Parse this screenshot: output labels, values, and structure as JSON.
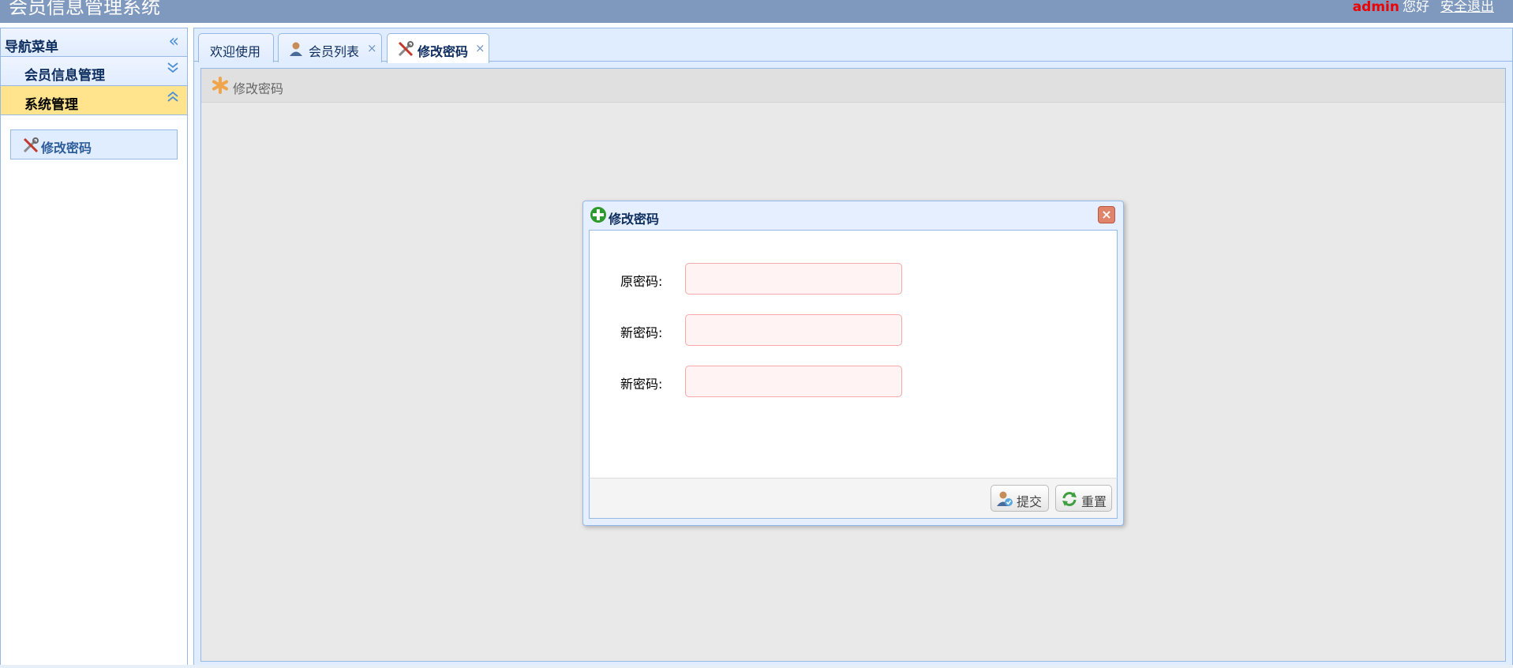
{
  "header": {
    "app_title": "会员信息管理系统",
    "username": "admin",
    "greeting": "您好",
    "logout_label": "安全退出"
  },
  "sidebar": {
    "title": "导航菜单",
    "sections": [
      {
        "label": "会员信息管理",
        "expanded": false
      },
      {
        "label": "系统管理",
        "expanded": true
      }
    ],
    "items": [
      {
        "label": "修改密码",
        "icon": "tools-icon"
      }
    ]
  },
  "tabs": [
    {
      "label": "欢迎使用",
      "closable": false,
      "active": false
    },
    {
      "label": "会员列表",
      "icon": "user-icon",
      "closable": true,
      "active": false
    },
    {
      "label": "修改密码",
      "icon": "tools-icon",
      "closable": true,
      "active": true
    }
  ],
  "tab_close_glyph": "×",
  "content": {
    "panel_title": "修改密码"
  },
  "dialog": {
    "title": "修改密码",
    "close_glyph": "×",
    "fields": [
      {
        "label": "原密码:",
        "value": ""
      },
      {
        "label": "新密码:",
        "value": ""
      },
      {
        "label": "新密码:",
        "value": ""
      }
    ],
    "buttons": {
      "submit": "提交",
      "reset": "重置"
    }
  },
  "colors": {
    "header_bg": "#7f99be",
    "border": "#95b8e7",
    "selected_section": "#ffe48d",
    "invalid_input_border": "#f5a9a9",
    "username": "#ee0000"
  }
}
